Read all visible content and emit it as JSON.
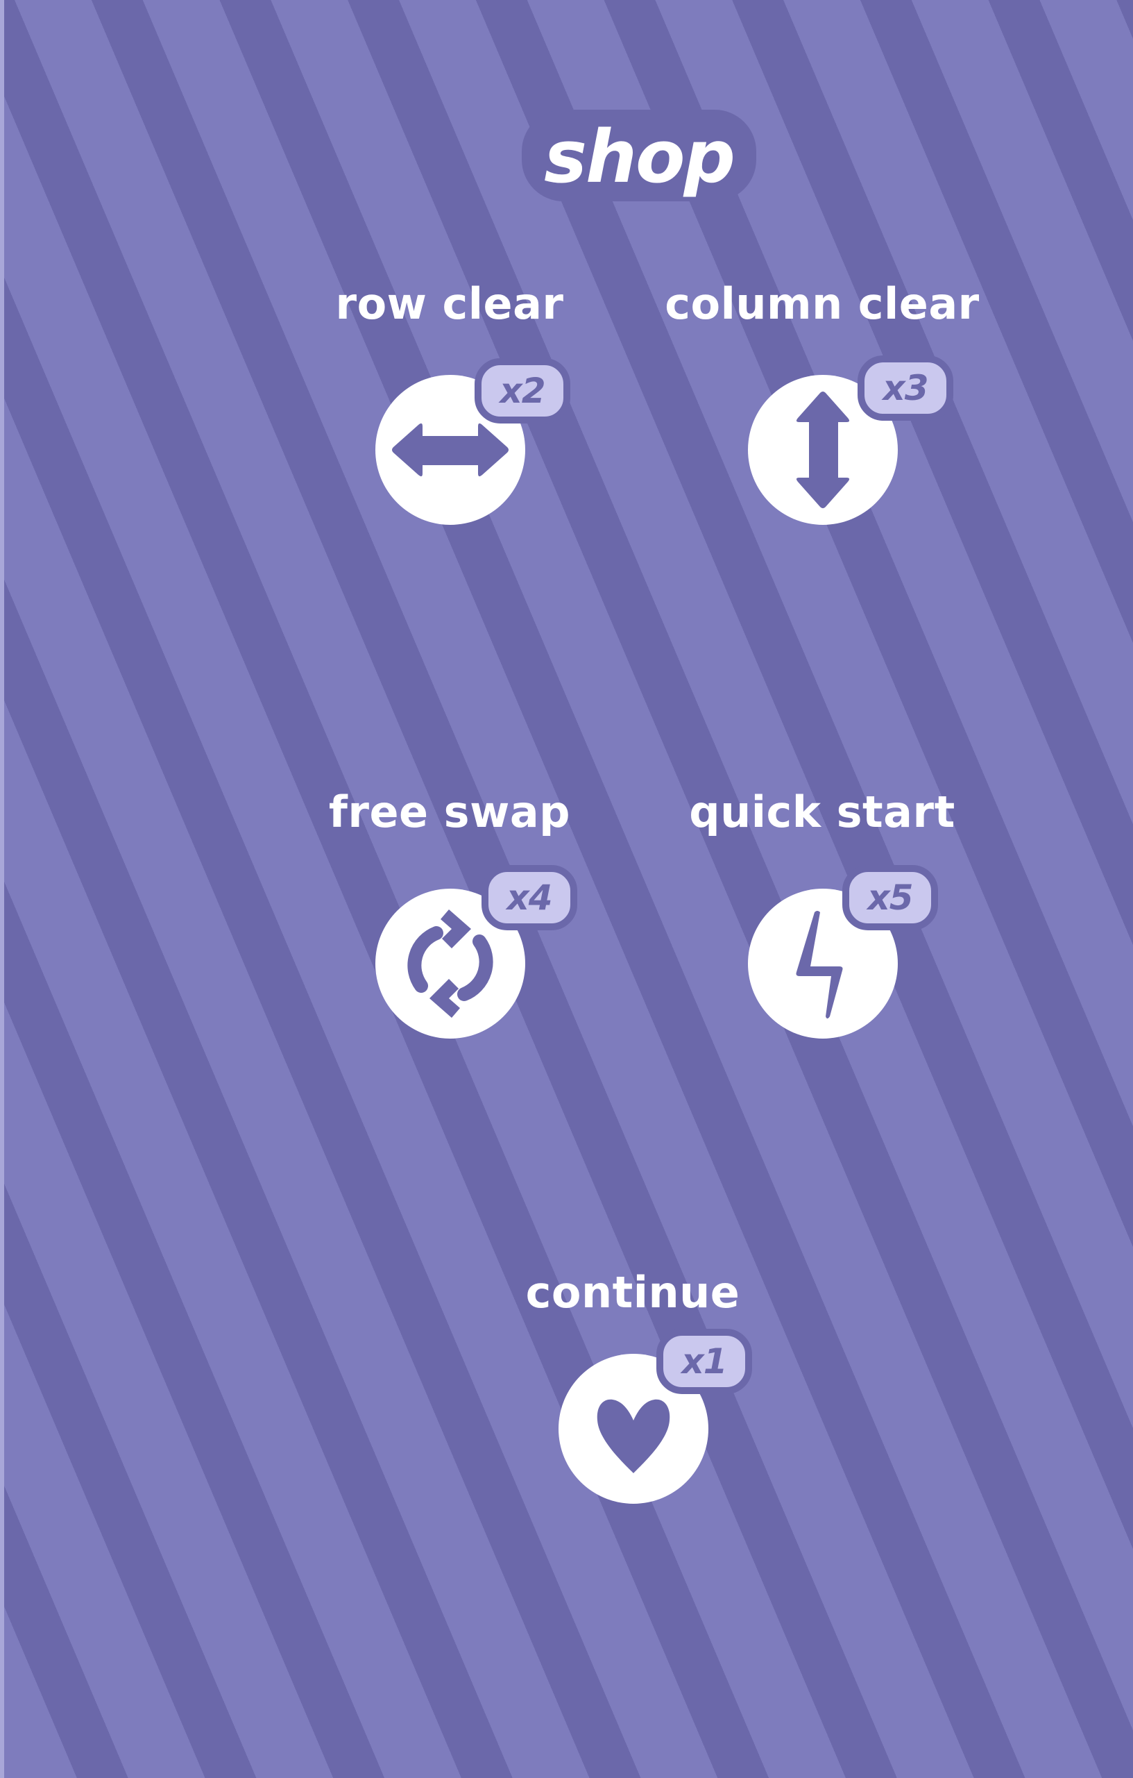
{
  "title": "shop",
  "colors": {
    "stripe_light": "#7e7cbd",
    "stripe_dark": "#6b68aa",
    "badge_fill": "#cac8ee",
    "white": "#ffffff"
  },
  "items": [
    {
      "label": "row clear",
      "price": "x2",
      "icon": "horizontal-arrows-icon"
    },
    {
      "label": "column clear",
      "price": "x3",
      "icon": "vertical-arrows-icon"
    },
    {
      "label": "free swap",
      "price": "x4",
      "icon": "swap-cycle-icon"
    },
    {
      "label": "quick start",
      "price": "x5",
      "icon": "lightning-icon"
    },
    {
      "label": "continue",
      "price": "x1",
      "icon": "heart-icon"
    }
  ]
}
